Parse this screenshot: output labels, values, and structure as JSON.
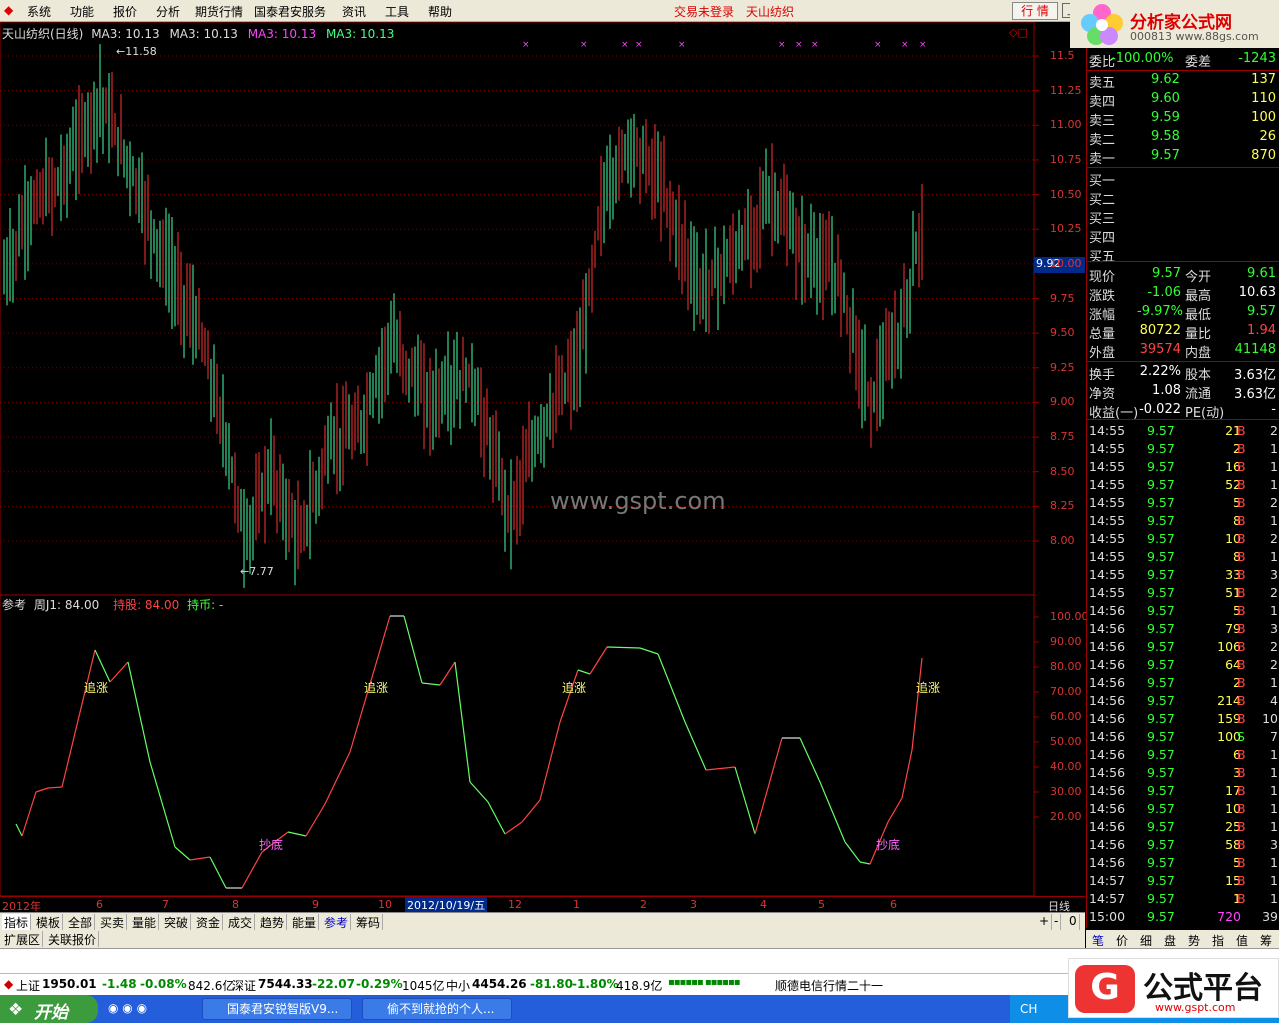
{
  "menu": [
    "系统",
    "功能",
    "报价",
    "分析",
    "期货行情",
    "国泰君安服务",
    "资讯",
    "工具",
    "帮助"
  ],
  "login_status": "交易未登录",
  "stock_name_title": "天山纺织",
  "quote_button": "行 情",
  "window_buttons": [
    "_",
    "□",
    "×"
  ],
  "logo": {
    "title": "分析家公式网",
    "url": "www.88gs.com",
    "code_fragment": "000813"
  },
  "main_chart": {
    "header": {
      "name": "天山纺织(日线)",
      "ma1": "MA3: 10.13",
      "ma2": "MA3: 10.13",
      "ma3": "MA3: 10.13",
      "ma4": "MA3: 10.13"
    },
    "price_ticks": [
      "11.5",
      "11.25",
      "11.00",
      "10.75",
      "10.50",
      "10.25",
      "10.00",
      "9.75",
      "9.50",
      "9.25",
      "9.00",
      "8.75",
      "8.50",
      "8.25",
      "8.00"
    ],
    "current_price_tag": "9.92",
    "high_label": "11.58",
    "low_label": "7.77",
    "watermark": "www.gspt.com"
  },
  "indicator": {
    "header": {
      "label": "参考",
      "j1": "周J1: 84.00",
      "hold_stock": "持股: 84.00",
      "hold_cash": "持币: -"
    },
    "ticks": [
      "100.00",
      "90.00",
      "80.00",
      "70.00",
      "60.00",
      "50.00",
      "40.00",
      "30.00",
      "20.00"
    ],
    "annotations": {
      "chase": "追涨",
      "bottom": "抄底"
    }
  },
  "time_axis": {
    "labels": [
      "2012年",
      "6",
      "7",
      "8",
      "9",
      "10",
      "12",
      "1",
      "2",
      "3",
      "4",
      "5",
      "6"
    ],
    "cursor_date": "2012/10/19/五",
    "period": "日线"
  },
  "bottom_tabs": [
    "指标",
    "模板",
    "全部",
    "买卖",
    "量能",
    "突破",
    "资金",
    "成交",
    "趋势",
    "能量",
    "参考",
    "筹码"
  ],
  "ext_tabs": [
    "扩展区",
    "关联报价"
  ],
  "zoom_buttons": [
    "+",
    "-",
    "0"
  ],
  "right_panel": {
    "ratio": {
      "label1": "委比",
      "val1": "-100.00%",
      "label2": "委差",
      "val2": "-1243"
    },
    "asks": [
      {
        "label": "卖五",
        "price": "9.62",
        "vol": "137"
      },
      {
        "label": "卖四",
        "price": "9.60",
        "vol": "110"
      },
      {
        "label": "卖三",
        "price": "9.59",
        "vol": "100"
      },
      {
        "label": "卖二",
        "price": "9.58",
        "vol": "26"
      },
      {
        "label": "卖一",
        "price": "9.57",
        "vol": "870"
      }
    ],
    "bids": [
      "买一",
      "买二",
      "买三",
      "买四",
      "买五"
    ],
    "stats": [
      {
        "l1": "现价",
        "v1": "9.57",
        "l2": "今开",
        "v2": "9.61",
        "c1": "#33ff33",
        "c2": "#33ff33"
      },
      {
        "l1": "涨跌",
        "v1": "-1.06",
        "l2": "最高",
        "v2": "10.63",
        "c1": "#33ff33",
        "c2": "#ffffff"
      },
      {
        "l1": "涨幅",
        "v1": "-9.97%",
        "l2": "最低",
        "v2": "9.57",
        "c1": "#33ff33",
        "c2": "#33ff33"
      },
      {
        "l1": "总量",
        "v1": "80722",
        "l2": "量比",
        "v2": "1.94",
        "c1": "#ffff55",
        "c2": "#ff4444"
      },
      {
        "l1": "外盘",
        "v1": "39574",
        "l2": "内盘",
        "v2": "41148",
        "c1": "#ff4444",
        "c2": "#33ff33"
      },
      {
        "l1": "换手",
        "v1": "2.22%",
        "l2": "股本",
        "v2": "3.63亿",
        "c1": "#ffffff",
        "c2": "#ffffff"
      },
      {
        "l1": "净资",
        "v1": "1.08",
        "l2": "流通",
        "v2": "3.63亿",
        "c1": "#ffffff",
        "c2": "#ffffff"
      },
      {
        "l1": "收益(一)",
        "v1": "-0.022",
        "l2": "PE(动)",
        "v2": "-",
        "c1": "#ffffff",
        "c2": "#ffffff"
      }
    ],
    "ticks": [
      {
        "t": "14:55",
        "p": "9.57",
        "v": "21",
        "d": "B",
        "n": "2"
      },
      {
        "t": "14:55",
        "p": "9.57",
        "v": "2",
        "d": "B",
        "n": "1"
      },
      {
        "t": "14:55",
        "p": "9.57",
        "v": "16",
        "d": "B",
        "n": "1"
      },
      {
        "t": "14:55",
        "p": "9.57",
        "v": "52",
        "d": "B",
        "n": "1"
      },
      {
        "t": "14:55",
        "p": "9.57",
        "v": "5",
        "d": "B",
        "n": "2"
      },
      {
        "t": "14:55",
        "p": "9.57",
        "v": "8",
        "d": "B",
        "n": "1"
      },
      {
        "t": "14:55",
        "p": "9.57",
        "v": "10",
        "d": "B",
        "n": "2"
      },
      {
        "t": "14:55",
        "p": "9.57",
        "v": "8",
        "d": "B",
        "n": "1"
      },
      {
        "t": "14:55",
        "p": "9.57",
        "v": "33",
        "d": "B",
        "n": "3"
      },
      {
        "t": "14:55",
        "p": "9.57",
        "v": "51",
        "d": "B",
        "n": "2"
      },
      {
        "t": "14:56",
        "p": "9.57",
        "v": "5",
        "d": "B",
        "n": "1"
      },
      {
        "t": "14:56",
        "p": "9.57",
        "v": "79",
        "d": "B",
        "n": "3"
      },
      {
        "t": "14:56",
        "p": "9.57",
        "v": "106",
        "d": "B",
        "n": "2"
      },
      {
        "t": "14:56",
        "p": "9.57",
        "v": "64",
        "d": "B",
        "n": "2"
      },
      {
        "t": "14:56",
        "p": "9.57",
        "v": "2",
        "d": "B",
        "n": "1"
      },
      {
        "t": "14:56",
        "p": "9.57",
        "v": "214",
        "d": "B",
        "n": "4"
      },
      {
        "t": "14:56",
        "p": "9.57",
        "v": "159",
        "d": "B",
        "n": "10"
      },
      {
        "t": "14:56",
        "p": "9.57",
        "v": "100",
        "d": "S",
        "n": "7"
      },
      {
        "t": "14:56",
        "p": "9.57",
        "v": "6",
        "d": "B",
        "n": "1"
      },
      {
        "t": "14:56",
        "p": "9.57",
        "v": "3",
        "d": "B",
        "n": "1"
      },
      {
        "t": "14:56",
        "p": "9.57",
        "v": "17",
        "d": "B",
        "n": "1"
      },
      {
        "t": "14:56",
        "p": "9.57",
        "v": "10",
        "d": "B",
        "n": "1"
      },
      {
        "t": "14:56",
        "p": "9.57",
        "v": "25",
        "d": "B",
        "n": "1"
      },
      {
        "t": "14:56",
        "p": "9.57",
        "v": "58",
        "d": "B",
        "n": "3"
      },
      {
        "t": "14:56",
        "p": "9.57",
        "v": "5",
        "d": "B",
        "n": "1"
      },
      {
        "t": "14:57",
        "p": "9.57",
        "v": "15",
        "d": "B",
        "n": "1"
      },
      {
        "t": "14:57",
        "p": "9.57",
        "v": "1",
        "d": "B",
        "n": "1"
      },
      {
        "t": "15:00",
        "p": "9.57",
        "v": "720",
        "d": "",
        "n": "39"
      }
    ],
    "tabs": [
      "笔",
      "价",
      "细",
      "盘",
      "势",
      "指",
      "值",
      "筹"
    ]
  },
  "index_bar": {
    "sh_label": "上证",
    "sh_val": "1950.01",
    "sh_chg": "-1.48",
    "sh_pct": "-0.08%",
    "sh_amt": "842.6亿",
    "sz_label": "深证",
    "sz_val": "7544.33",
    "sz_chg": "-22.07",
    "sz_pct": "-0.29%",
    "sz_amt": "1045亿",
    "zx_label": "中小",
    "zx_val": "4454.26",
    "zx_chg": "-81.80",
    "zx_pct": "-1.80%",
    "zx_amt": "418.9亿",
    "news": "顺德电信行情二十一"
  },
  "taskbar": {
    "start": "开始",
    "tasks": [
      "国泰君安锐智版V9...",
      "偷不到就抢的个人..."
    ],
    "tray_text": "CH"
  },
  "gspt_logo": {
    "title": "公式平台",
    "url": "www.gspt.com"
  }
}
